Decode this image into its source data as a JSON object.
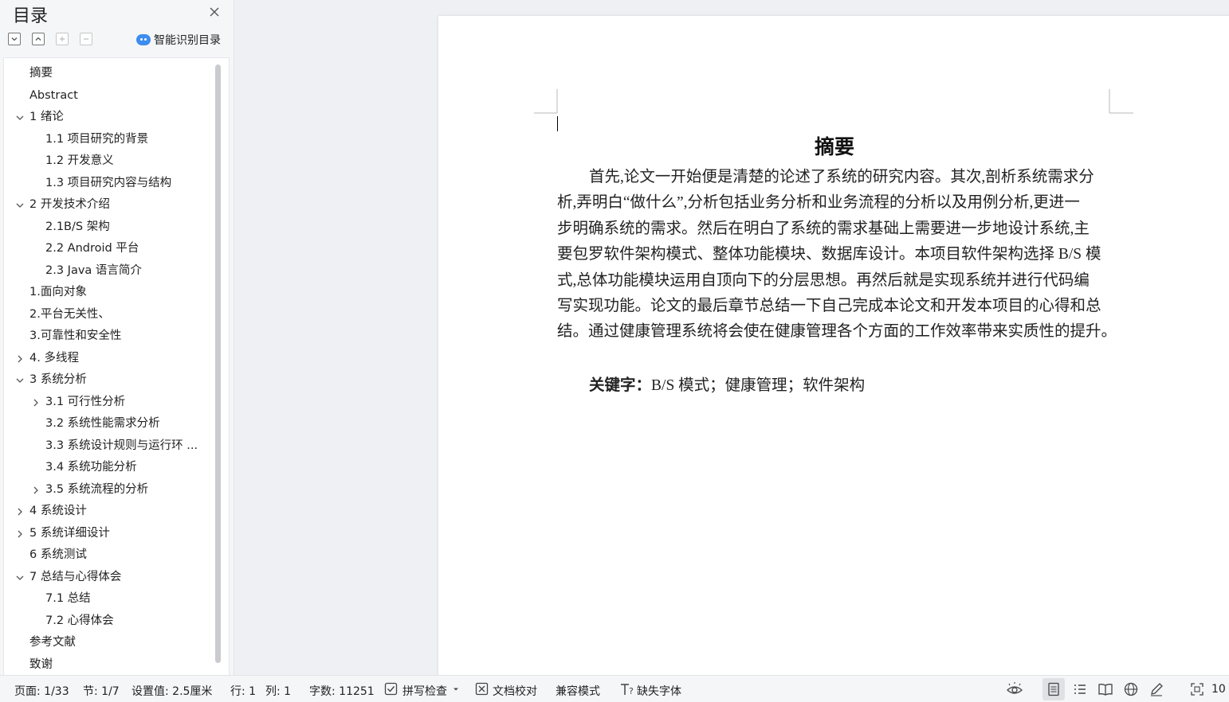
{
  "sidebar": {
    "title": "目录",
    "smart_toc_label": "智能识别目录",
    "toc": [
      {
        "label": "摘要",
        "level": 1,
        "toggle": "none"
      },
      {
        "label": "Abstract",
        "level": 1,
        "toggle": "none"
      },
      {
        "label": "1 绪论",
        "level": 1,
        "toggle": "expanded"
      },
      {
        "label": "1.1 项目研究的背景",
        "level": 2,
        "toggle": "none"
      },
      {
        "label": "1.2 开发意义",
        "level": 2,
        "toggle": "none"
      },
      {
        "label": "1.3 项目研究内容与结构",
        "level": 2,
        "toggle": "none"
      },
      {
        "label": "2 开发技术介绍",
        "level": 1,
        "toggle": "expanded"
      },
      {
        "label": "2.1B/S 架构",
        "level": 2,
        "toggle": "none"
      },
      {
        "label": "2.2 Android 平台",
        "level": 2,
        "toggle": "none"
      },
      {
        "label": "2.3 Java 语言简介",
        "level": 2,
        "toggle": "none"
      },
      {
        "label": "1.面向对象",
        "level": 1,
        "toggle": "none"
      },
      {
        "label": "2.平台无关性、",
        "level": 1,
        "toggle": "none"
      },
      {
        "label": "3.可靠性和安全性",
        "level": 1,
        "toggle": "none"
      },
      {
        "label": "4.  多线程",
        "level": 1,
        "toggle": "collapsed"
      },
      {
        "label": "3 系统分析",
        "level": 1,
        "toggle": "expanded"
      },
      {
        "label": "3.1 可行性分析",
        "level": 2,
        "toggle": "collapsed"
      },
      {
        "label": "3.2  系统性能需求分析",
        "level": 2,
        "toggle": "none"
      },
      {
        "label": "3.3 系统设计规则与运行环 ...",
        "level": 2,
        "toggle": "none"
      },
      {
        "label": "3.4  系统功能分析",
        "level": 2,
        "toggle": "none"
      },
      {
        "label": "3.5 系统流程的分析",
        "level": 2,
        "toggle": "collapsed"
      },
      {
        "label": "4 系统设计",
        "level": 1,
        "toggle": "collapsed"
      },
      {
        "label": "5 系统详细设计",
        "level": 1,
        "toggle": "collapsed"
      },
      {
        "label": "6 系统测试",
        "level": 1,
        "toggle": "none"
      },
      {
        "label": "7 总结与心得体会",
        "level": 1,
        "toggle": "expanded"
      },
      {
        "label": "7.1  总结",
        "level": 2,
        "toggle": "none"
      },
      {
        "label": "7.2  心得体会",
        "level": 2,
        "toggle": "none"
      },
      {
        "label": "参考文献",
        "level": 1,
        "toggle": "none"
      },
      {
        "label": "致谢",
        "level": 1,
        "toggle": "none"
      }
    ]
  },
  "document": {
    "title": "摘要",
    "lines": [
      "首先,论文一开始便是清楚的论述了系统的研究内容。其次,剖析系统需求分",
      "析,弄明白“做什么”,分析包括业务分析和业务流程的分析以及用例分析,更进一",
      "步明确系统的需求。然后在明白了系统的需求基础上需要进一步地设计系统,主",
      "要包罗软件架构模式、整体功能模块、数据库设计。本项目软件架构选择 B/S 模",
      "式,总体功能模块运用自顶向下的分层思想。再然后就是实现系统并进行代码编",
      "写实现功能。论文的最后章节总结一下自己完成本论文和开发本项目的心得和总",
      "结。通过健康管理系统将会使在健康管理各个方面的工作效率带来实质性的提升。"
    ],
    "keywords_label": "关键字：",
    "keywords_value": "B/S 模式；健康管理；软件架构"
  },
  "statusbar": {
    "page": "页面: 1/33",
    "section": "节: 1/7",
    "setting": "设置值: 2.5厘米",
    "row": "行: 1",
    "col": "列: 1",
    "word_count": "字数: 11251",
    "spell_check": "拼写检查",
    "doc_proof": "文档校对",
    "compat_mode": "兼容模式",
    "missing_fonts": "缺失字体",
    "zoom": "10"
  }
}
